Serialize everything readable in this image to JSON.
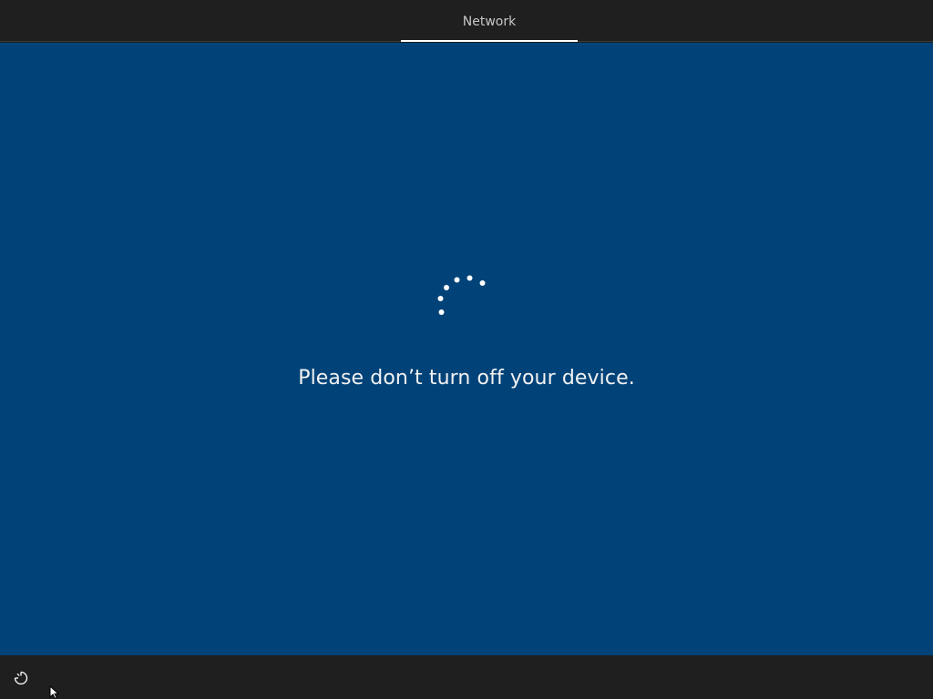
{
  "topbar": {
    "tabs": [
      {
        "label": "Network",
        "active": true
      }
    ]
  },
  "main": {
    "message": "Please don’t turn off your device.",
    "spinner_icon": "loading-dots-spinner"
  },
  "bottombar": {
    "ease_of_access_icon": "ease-of-access-icon"
  },
  "colors": {
    "background_blue": "#014378",
    "bar_dark": "#1f1f1f",
    "text": "#f2f2f2",
    "tab_text": "#c8c8c8"
  }
}
